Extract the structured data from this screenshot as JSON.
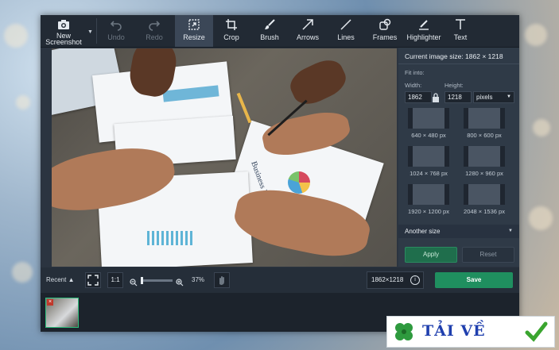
{
  "toolbar": {
    "tools": [
      {
        "label": "New\nScreenshot",
        "icon": "camera-icon",
        "state": "normal"
      },
      {
        "label": "Undo",
        "icon": "undo-icon",
        "state": "disabled"
      },
      {
        "label": "Redo",
        "icon": "redo-icon",
        "state": "disabled"
      },
      {
        "label": "Resize",
        "icon": "resize-icon",
        "state": "active"
      },
      {
        "label": "Crop",
        "icon": "crop-icon",
        "state": "normal"
      },
      {
        "label": "Brush",
        "icon": "brush-icon",
        "state": "normal"
      },
      {
        "label": "Arrows",
        "icon": "arrow-icon",
        "state": "normal"
      },
      {
        "label": "Lines",
        "icon": "line-icon",
        "state": "normal"
      },
      {
        "label": "Frames",
        "icon": "frames-icon",
        "state": "normal"
      },
      {
        "label": "Highlighter",
        "icon": "highlighter-icon",
        "state": "normal"
      },
      {
        "label": "Text",
        "icon": "text-icon",
        "state": "normal"
      }
    ]
  },
  "panel": {
    "current_size": "Current image size: 1862 × 1218",
    "fit_into": "Fit into:",
    "width_label": "Width:",
    "height_label": "Height:",
    "width_value": "1862",
    "height_value": "1218",
    "unit": "pixels",
    "presets": [
      "640 × 480 px",
      "800 × 600 px",
      "1024 × 768 px",
      "1280 × 960 px",
      "1920 × 1200 px",
      "2048 × 1536 px"
    ],
    "another_size": "Another size",
    "apply": "Apply",
    "reset": "Reset"
  },
  "bottombar": {
    "recent": "Recent ▲",
    "ratio": "1:1",
    "zoom": "37%",
    "dimensions": "1862×1218",
    "save": "Save"
  },
  "canvas": {
    "paper_text": "Business Report"
  },
  "watermark": {
    "text": "TẢI VỀ"
  },
  "colors": {
    "accent_green": "#1f8f5f",
    "toolbar_bg": "#222a34",
    "panel_bg": "#2f3a47",
    "active_tool": "#3b4757"
  }
}
